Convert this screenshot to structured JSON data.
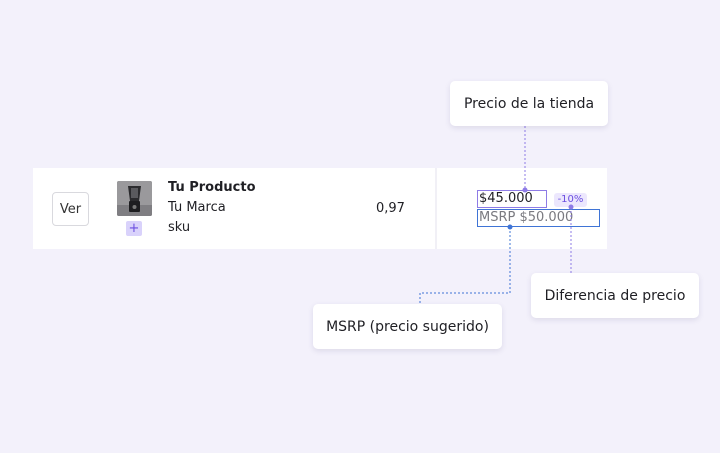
{
  "row": {
    "view_button": "Ver",
    "product_image": "blender-image",
    "add_icon": "+",
    "product_name": "Tu Producto",
    "brand": "Tu Marca",
    "sku": "sku",
    "quantity": "0,97",
    "store_price": "$45.000",
    "price_difference": "-10%",
    "msrp": "MSRP $50.000"
  },
  "callouts": {
    "store_price": "Precio de la tienda",
    "price_difference": "Diferencia de precio",
    "msrp": "MSRP (precio sugerido)"
  },
  "colors": {
    "background": "#f3f1fb",
    "accent_purple": "#8e7be6",
    "accent_blue": "#3f74d6",
    "badge_bg": "#ece7fd"
  }
}
